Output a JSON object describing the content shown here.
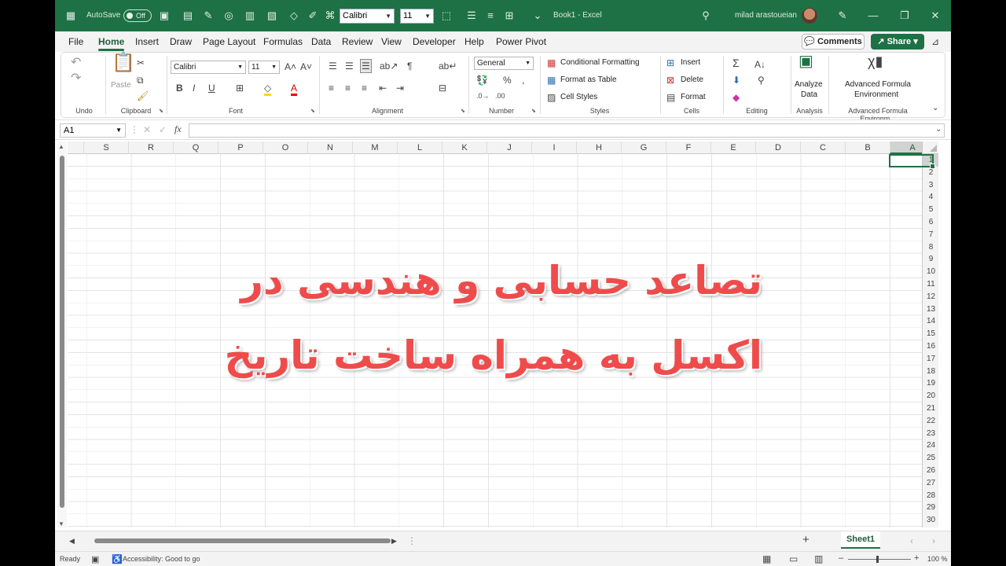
{
  "titlebar": {
    "autosave_label": "AutoSave",
    "autosave_state": "Off",
    "font_name": "Calibri",
    "font_size": "11",
    "doc_title": "Book1 - Excel",
    "user_name": "milad arastoueian",
    "bg_color": "#1e7145"
  },
  "menu": {
    "tabs": [
      "File",
      "Home",
      "Insert",
      "Draw",
      "Page Layout",
      "Formulas",
      "Data",
      "Review",
      "View",
      "Developer",
      "Help",
      "Power Pivot"
    ],
    "active": "Home",
    "comments_label": "Comments",
    "share_label": "Share"
  },
  "ribbon": {
    "groups": [
      "Undo",
      "Clipboard",
      "Font",
      "Alignment",
      "Number",
      "Styles",
      "Cells",
      "Editing",
      "Analysis",
      "Advanced Formula Environm..."
    ],
    "paste_label": "Paste",
    "font_name": "Calibri",
    "font_size": "11",
    "number_format": "General",
    "styles": [
      "Conditional Formatting",
      "Format as Table",
      "Cell Styles"
    ],
    "cells": [
      "Insert",
      "Delete",
      "Format"
    ],
    "analyze_label": [
      "Analyze",
      "Data"
    ],
    "afe_label": [
      "Advanced Formula",
      "Environment"
    ]
  },
  "formula_bar": {
    "name_box": "A1",
    "fx_label": "fx",
    "value": ""
  },
  "grid": {
    "columns": [
      "S",
      "R",
      "Q",
      "P",
      "O",
      "N",
      "M",
      "L",
      "K",
      "J",
      "I",
      "H",
      "G",
      "F",
      "E",
      "D",
      "C",
      "B",
      "A"
    ],
    "rows": [
      "1",
      "2",
      "3",
      "4",
      "5",
      "6",
      "7",
      "8",
      "9",
      "10",
      "11",
      "12",
      "13",
      "14",
      "15",
      "16",
      "17",
      "18",
      "19",
      "20",
      "21",
      "22",
      "23",
      "24",
      "25",
      "26",
      "27",
      "28",
      "29",
      "30"
    ],
    "selected_column": "A",
    "selected_row": "1"
  },
  "overlay": {
    "line1": "تصاعد حسابی و هندسی در",
    "line2": "اکسل به همراه ساخت تاریخ",
    "color": "#ef4b4b"
  },
  "sheets": {
    "tabs": [
      "Sheet1"
    ],
    "active": "Sheet1"
  },
  "status": {
    "ready": "Ready",
    "accessibility": "Accessibility: Good to go",
    "zoom": "100 %"
  }
}
